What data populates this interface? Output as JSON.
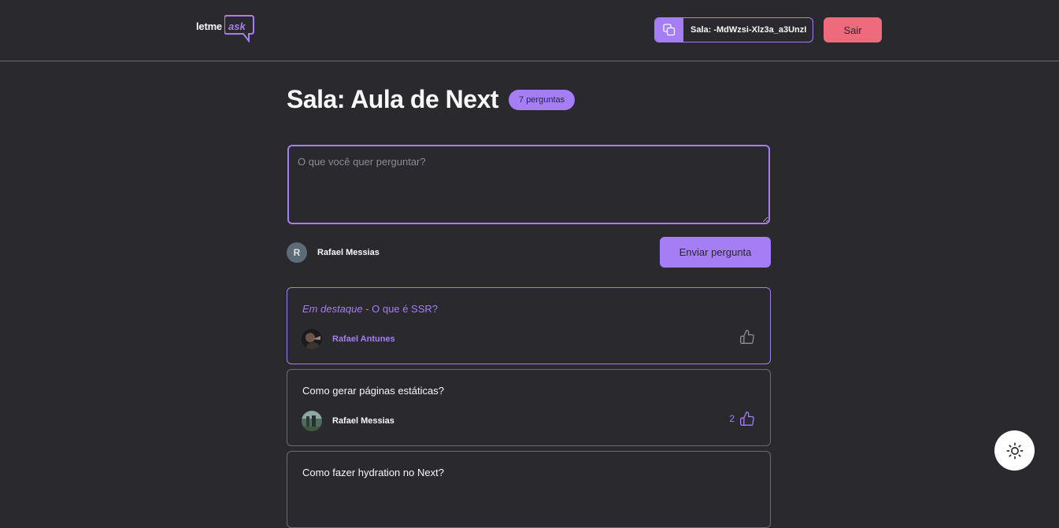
{
  "header": {
    "logo": {
      "part1": "letme",
      "part2": "ask"
    },
    "room_code_label": "Sala: -MdWzsi-Xlz3a_a3UnzI",
    "logout_label": "Sair"
  },
  "room": {
    "title": "Sala: Aula de Next",
    "question_count": "7 perguntas"
  },
  "form": {
    "placeholder": "O que você quer perguntar?",
    "user_initial": "R",
    "user_name": "Rafael Messias",
    "send_label": "Enviar pergunta"
  },
  "questions": [
    {
      "highlight_prefix": "Em destaque",
      "separator": " - ",
      "content": "O que é SSR?",
      "author": "Rafael Antunes",
      "likes": ""
    },
    {
      "content": "Como gerar páginas estáticas?",
      "author": "Rafael Messias",
      "likes": "2"
    },
    {
      "content": "Como fazer hydration no Next?"
    }
  ],
  "colors": {
    "background": "#29292e",
    "accent": "#a57ef5",
    "danger": "#ee6b7c",
    "border": "#6c6c72",
    "text": "#f8f8f8"
  },
  "icons": {
    "copy": "copy-icon",
    "like": "thumbs-up-icon",
    "theme": "sun-icon"
  }
}
